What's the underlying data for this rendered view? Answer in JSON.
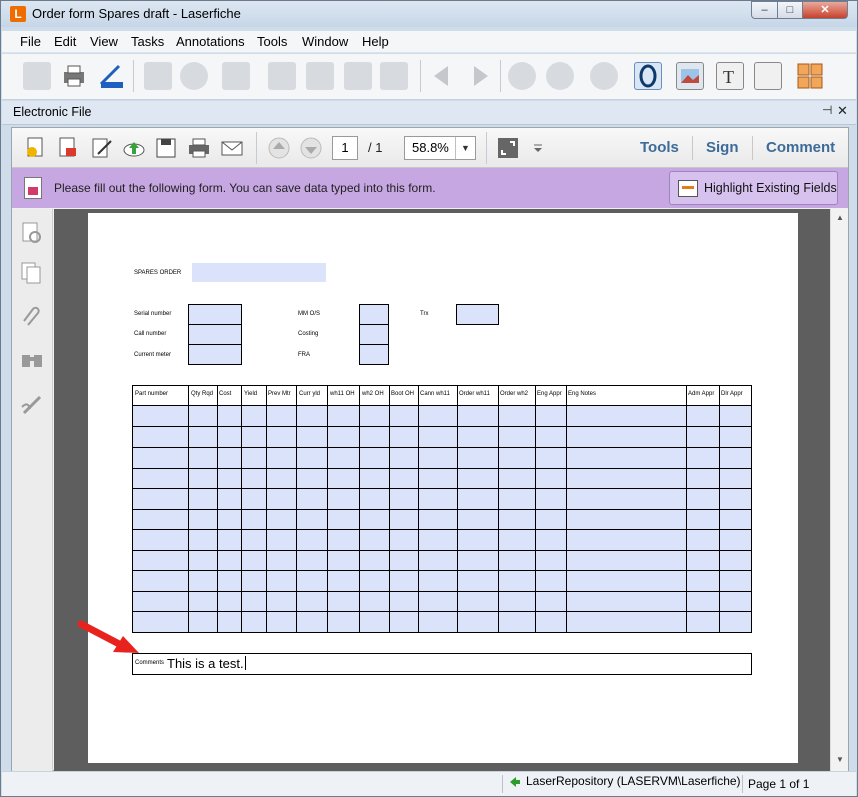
{
  "window": {
    "title": "Order form Spares draft - Laserfiche",
    "logo_letter": "L",
    "controls": {
      "minimize": "–",
      "maximize": "□",
      "close": "✕"
    }
  },
  "menu": [
    "File",
    "Edit",
    "View",
    "Tasks",
    "Annotations",
    "Tools",
    "Window",
    "Help"
  ],
  "panel": {
    "title": "Electronic File",
    "pin": "⊣",
    "close": "✕"
  },
  "pdf_toolbar": {
    "page_current": "1",
    "page_total": "/ 1",
    "zoom": "58.8%",
    "zoom_dropdown": "▼",
    "links": [
      "Tools",
      "Sign",
      "Comment"
    ]
  },
  "form_bar": {
    "message": "Please fill out the following form. You can save data typed into this form.",
    "highlight_button": "Highlight Existing Fields"
  },
  "form": {
    "spares_order_label": "SPARES ORDER",
    "fields": {
      "serial_number": "Serial number",
      "call_number": "Call number",
      "current_meter": "Current meter",
      "mm_os": "MM O/S",
      "costing": "Costing",
      "fra": "FRA",
      "trx": "Trx"
    },
    "table_columns": [
      "Part number",
      "Qty Rqd",
      "Cost",
      "Yield",
      "Prev Mtr",
      "Curr yld",
      "wh11 OH",
      "wh2 OH",
      "Boot OH",
      "Cann wh11",
      "Order wh11",
      "Order wh2",
      "Eng Appr",
      "Eng Notes",
      "Adm Appr",
      "Dlr Appr"
    ],
    "comments_label": "Comments",
    "comments_value": "This is a test."
  },
  "status": {
    "repository": "LaserRepository (LASERVM\\Laserfiche)",
    "page_info": "Page 1 of 1"
  },
  "colors": {
    "form_bar": "#c6a7e2",
    "field_fill": "#dbe3fb",
    "arrow": "#e8231d",
    "link": "#3d6b99"
  },
  "icons": {
    "toolbar": [
      "save-icon",
      "print-icon",
      "scanner-icon",
      "pan-hand-icon",
      "zoom-in-icon",
      "stamp-icon",
      "sticky-note-icon",
      "pen-icon",
      "highlighter-icon",
      "text-icon",
      "back-icon",
      "forward-icon",
      "zoom-in-circle-icon",
      "zoom-out-circle-icon",
      "refresh-icon",
      "ocr-icon",
      "image-icon",
      "text-box-icon",
      "list-icon",
      "thumbnails-icon"
    ],
    "pdf_toolbar": [
      "open-file-icon",
      "create-pdf-icon",
      "edit-icon",
      "cloud-upload-icon",
      "save-icon",
      "print-icon",
      "email-icon",
      "prev-page-icon",
      "next-page-icon",
      "fullscreen-icon",
      "more-icon"
    ],
    "side": [
      "page-thumbnails-icon",
      "copy-pages-icon",
      "attachment-icon",
      "search-icon",
      "signature-icon"
    ]
  }
}
